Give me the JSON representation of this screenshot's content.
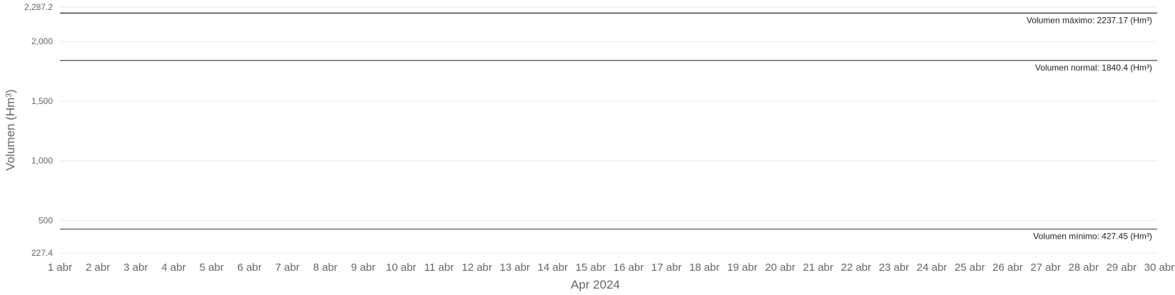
{
  "chart_data": {
    "type": "line",
    "title": "",
    "ylabel": "Volumen (Hm³)",
    "xlabel": "Apr 2024",
    "ylim": [
      227.4,
      2287.2
    ],
    "y_ticks": [
      {
        "value": 227.4,
        "label": "227.4"
      },
      {
        "value": 500,
        "label": "500"
      },
      {
        "value": 1000,
        "label": "1,000"
      },
      {
        "value": 1500,
        "label": "1,500"
      },
      {
        "value": 2000,
        "label": "2,000"
      },
      {
        "value": 2287.2,
        "label": "2,287.2"
      }
    ],
    "categories": [
      "1 abr",
      "2 abr",
      "3 abr",
      "4 abr",
      "5 abr",
      "6 abr",
      "7 abr",
      "8 abr",
      "9 abr",
      "10 abr",
      "11 abr",
      "12 abr",
      "13 abr",
      "14 abr",
      "15 abr",
      "16 abr",
      "17 abr",
      "18 abr",
      "19 abr",
      "20 abr",
      "21 abr",
      "22 abr",
      "23 abr",
      "24 abr",
      "25 abr",
      "26 abr",
      "27 abr",
      "28 abr",
      "29 abr",
      "30 abr"
    ],
    "series": [],
    "reference_lines": [
      {
        "value": 2237.17,
        "label": "Volumen máximo: 2237.17 (Hm³)",
        "color": "#222222"
      },
      {
        "value": 1840.4,
        "label": "Volumen normal: 1840.4 (Hm³)",
        "color": "#555555"
      },
      {
        "value": 427.45,
        "label": "Volumen mínimo: 427.45 (Hm³)",
        "color": "#555555"
      }
    ],
    "grid": true,
    "gridColor": "#ebebeb"
  }
}
